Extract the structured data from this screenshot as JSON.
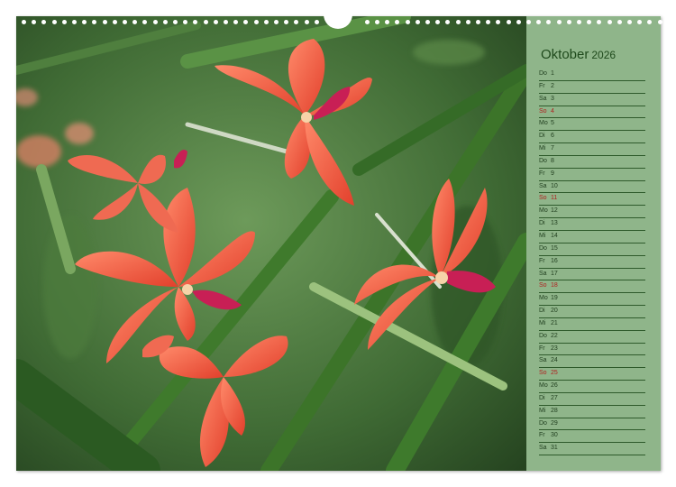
{
  "calendar": {
    "month": "Oktober",
    "year": "2026",
    "days": [
      {
        "dow": "Do",
        "num": "1",
        "sunday": false
      },
      {
        "dow": "Fr",
        "num": "2",
        "sunday": false
      },
      {
        "dow": "Sa",
        "num": "3",
        "sunday": false
      },
      {
        "dow": "So",
        "num": "4",
        "sunday": true
      },
      {
        "dow": "Mo",
        "num": "5",
        "sunday": false
      },
      {
        "dow": "Di",
        "num": "6",
        "sunday": false
      },
      {
        "dow": "Mi",
        "num": "7",
        "sunday": false
      },
      {
        "dow": "Do",
        "num": "8",
        "sunday": false
      },
      {
        "dow": "Fr",
        "num": "9",
        "sunday": false
      },
      {
        "dow": "Sa",
        "num": "10",
        "sunday": false
      },
      {
        "dow": "So",
        "num": "11",
        "sunday": true
      },
      {
        "dow": "Mo",
        "num": "12",
        "sunday": false
      },
      {
        "dow": "Di",
        "num": "13",
        "sunday": false
      },
      {
        "dow": "Mi",
        "num": "14",
        "sunday": false
      },
      {
        "dow": "Do",
        "num": "15",
        "sunday": false
      },
      {
        "dow": "Fr",
        "num": "16",
        "sunday": false
      },
      {
        "dow": "Sa",
        "num": "17",
        "sunday": false
      },
      {
        "dow": "So",
        "num": "18",
        "sunday": true
      },
      {
        "dow": "Mo",
        "num": "19",
        "sunday": false
      },
      {
        "dow": "Di",
        "num": "20",
        "sunday": false
      },
      {
        "dow": "Mi",
        "num": "21",
        "sunday": false
      },
      {
        "dow": "Do",
        "num": "22",
        "sunday": false
      },
      {
        "dow": "Fr",
        "num": "23",
        "sunday": false
      },
      {
        "dow": "Sa",
        "num": "24",
        "sunday": false
      },
      {
        "dow": "So",
        "num": "25",
        "sunday": true
      },
      {
        "dow": "Mo",
        "num": "26",
        "sunday": false
      },
      {
        "dow": "Di",
        "num": "27",
        "sunday": false
      },
      {
        "dow": "Mi",
        "num": "28",
        "sunday": false
      },
      {
        "dow": "Do",
        "num": "29",
        "sunday": false
      },
      {
        "dow": "Fr",
        "num": "30",
        "sunday": false
      },
      {
        "dow": "Sa",
        "num": "31",
        "sunday": false
      }
    ]
  },
  "colors": {
    "panel": "#8fb58a",
    "text": "#1f3d1d",
    "sunday": "#b02020",
    "petal": "#f0553f",
    "leaf": "#3f7a2c"
  }
}
